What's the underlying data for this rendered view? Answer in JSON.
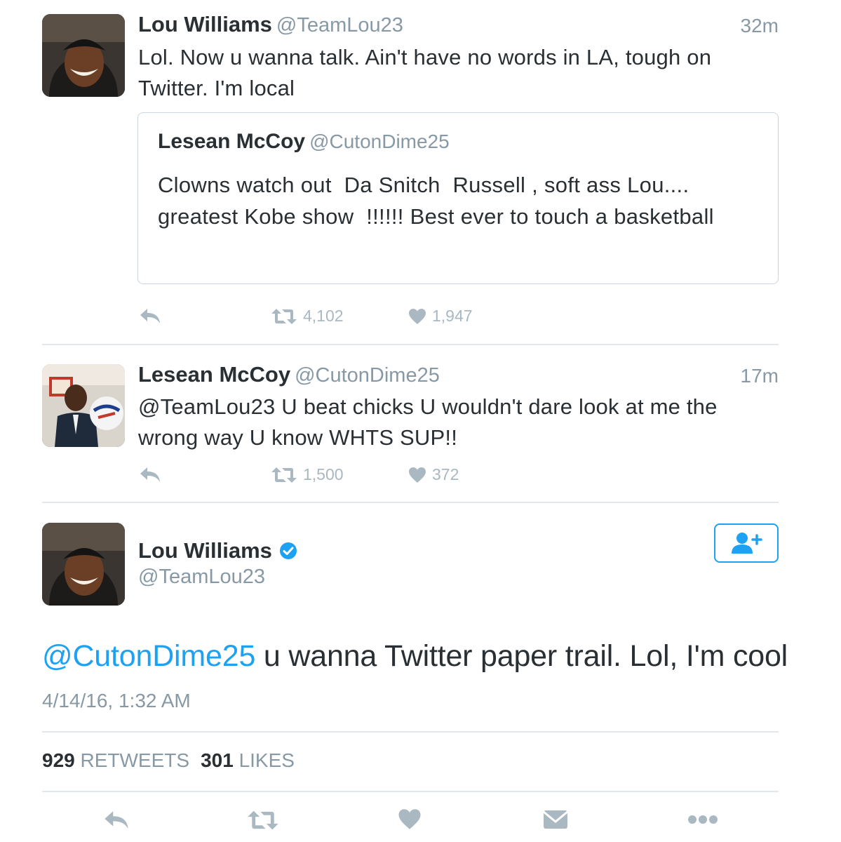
{
  "tweet1": {
    "name": "Lou Williams",
    "handle": "@TeamLou23",
    "time": "32m",
    "text": "Lol. Now u wanna talk. Ain't have no words in LA, tough on Twitter. I'm local",
    "quote": {
      "name": "Lesean McCoy",
      "handle": "@CutonDime25",
      "text": "Clowns watch out  Da Snitch  Russell , soft ass Lou.... greatest Kobe show  !!!!!! Best ever to touch a basketball"
    },
    "retweets": "4,102",
    "likes": "1,947"
  },
  "tweet2": {
    "name": "Lesean McCoy",
    "handle": "@CutonDime25",
    "time": "17m",
    "text": "@TeamLou23 U beat chicks U wouldn't dare look at me the wrong way U know WHTS SUP!!",
    "retweets": "1,500",
    "likes": "372"
  },
  "main": {
    "name": "Lou Williams",
    "handle": "@TeamLou23",
    "mention": "@CutonDime25",
    "text": " u wanna Twitter paper trail. Lol, I'm cool",
    "date": "4/14/16, 1:32 AM",
    "retweets_count": "929",
    "retweets_label": "RETWEETS",
    "likes_count": "301",
    "likes_label": "LIKES"
  },
  "icons": {
    "reply": "reply-icon",
    "retweet": "retweet-icon",
    "like": "heart-icon",
    "message": "envelope-icon",
    "more": "more-dots-icon",
    "verified": "verified-badge-icon",
    "follow": "follow-user-icon"
  },
  "colors": {
    "accent": "#1da1f2",
    "text": "#292f33",
    "muted": "#8899a6",
    "icon": "#aab8c2",
    "divider": "#e1e8ed"
  }
}
